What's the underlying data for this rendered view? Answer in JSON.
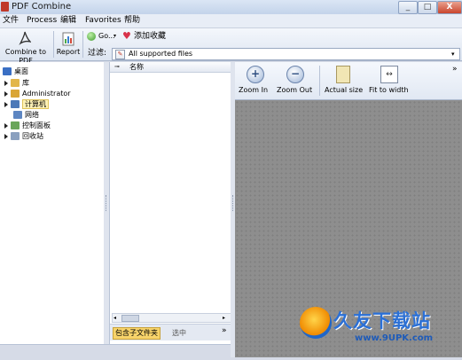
{
  "window": {
    "title": "PDF Combine",
    "min": "_",
    "max": "□",
    "close": "X"
  },
  "menu": [
    "文件",
    "Process",
    "编辑",
    "Favorites",
    "帮助"
  ],
  "toolbar": {
    "combine_label": "Combine to PDF",
    "report_label": "Report",
    "go_label": "Go...",
    "favorite_label": "添加收藏",
    "filter_label": "过滤:",
    "filter_value": "All supported files"
  },
  "tree": [
    {
      "label": "桌面",
      "expandable": false,
      "icon": "desktop-icon",
      "color": "#3a6fc4"
    },
    {
      "label": "库",
      "expandable": true,
      "icon": "library-icon",
      "color": "#e2b64a"
    },
    {
      "label": "Administrator",
      "expandable": true,
      "icon": "user-folder-icon",
      "color": "#d9a536"
    },
    {
      "label": "计算机",
      "expandable": true,
      "icon": "computer-icon",
      "color": "#4c79b8",
      "selected": true
    },
    {
      "label": "网络",
      "expandable": false,
      "icon": "network-icon",
      "color": "#5d86c2"
    },
    {
      "label": "控制面板",
      "expandable": true,
      "icon": "control-panel-icon",
      "color": "#6aa65a"
    },
    {
      "label": "回收站",
      "expandable": true,
      "icon": "recycle-bin-icon",
      "color": "#8aa0bf"
    }
  ],
  "filelist": {
    "column_name": "名称",
    "tab_include_subfolders": "包含子文件夹",
    "tab_selected": "选中",
    "more": "»"
  },
  "viewer": {
    "zoom_in": "Zoom In",
    "zoom_out": "Zoom Out",
    "actual_size": "Actual size",
    "fit_to_width": "Fit to width",
    "more": "»"
  },
  "watermark": {
    "text": "久友下载站",
    "url": "www.9UPK.com"
  }
}
